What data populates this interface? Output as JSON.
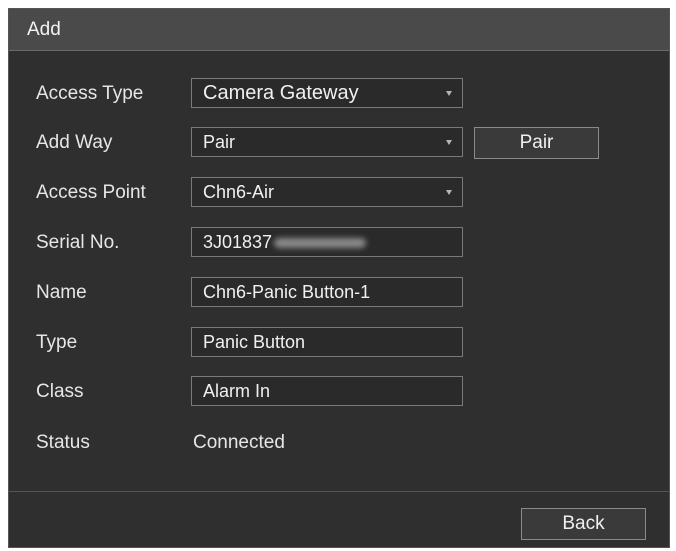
{
  "dialog": {
    "title": "Add"
  },
  "fields": {
    "access_type": {
      "label": "Access Type",
      "value": "Camera Gateway"
    },
    "add_way": {
      "label": "Add Way",
      "value": "Pair",
      "button": "Pair"
    },
    "access_point": {
      "label": "Access Point",
      "value": "Chn6-Air"
    },
    "serial": {
      "label": "Serial No.",
      "value": "3J01837"
    },
    "name": {
      "label": "Name",
      "value": "Chn6-Panic Button-1"
    },
    "type": {
      "label": "Type",
      "value": "Panic Button"
    },
    "class": {
      "label": "Class",
      "value": "Alarm In"
    },
    "status": {
      "label": "Status",
      "value": "Connected"
    }
  },
  "footer": {
    "back_label": "Back"
  },
  "icons": {
    "dropdown": "caret-down-icon"
  }
}
